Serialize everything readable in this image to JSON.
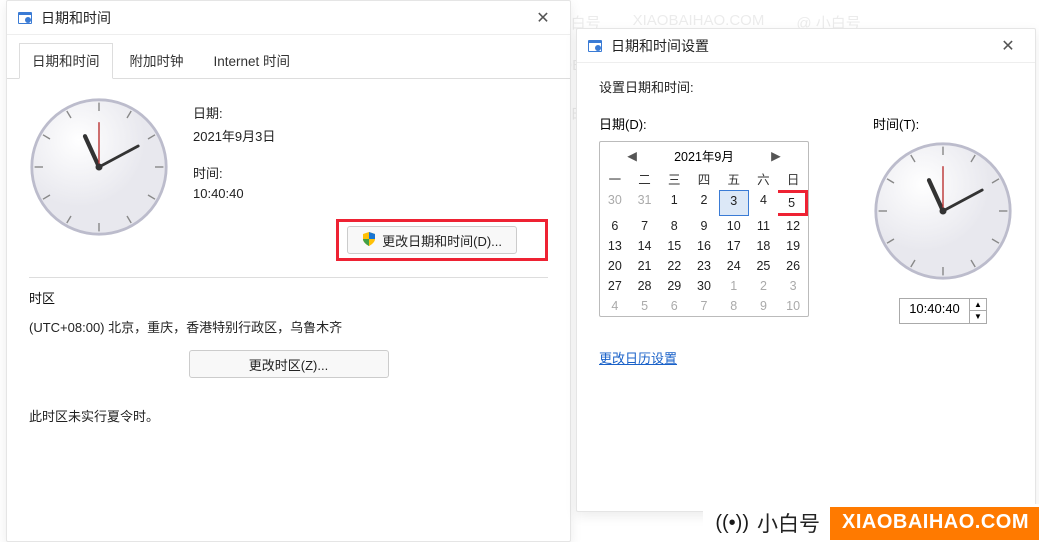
{
  "watermark": {
    "text1": "@ 小白号",
    "text2": "XIAOBAIHAO.COM"
  },
  "dialog1": {
    "title": "日期和时间",
    "tabs": [
      "日期和时间",
      "附加时钟",
      "Internet 时间"
    ],
    "date_label": "日期:",
    "date_value": "2021年9月3日",
    "time_label": "时间:",
    "time_value": "10:40:40",
    "change_datetime_btn": "更改日期和时间(D)...",
    "timezone_label": "时区",
    "timezone_value": "(UTC+08:00) 北京，重庆，香港特别行政区，乌鲁木齐",
    "change_timezone_btn": "更改时区(Z)...",
    "dst_note": "此时区未实行夏令时。"
  },
  "dialog2": {
    "title": "日期和时间设置",
    "set_label": "设置日期和时间:",
    "date_label": "日期(D):",
    "time_label": "时间(T):",
    "calendar": {
      "title": "2021年9月",
      "dow": [
        "一",
        "二",
        "三",
        "四",
        "五",
        "六",
        "日"
      ],
      "week1": [
        "30",
        "31",
        "1",
        "2",
        "3",
        "4",
        "5"
      ],
      "week2": [
        "6",
        "7",
        "8",
        "9",
        "10",
        "11",
        "12"
      ],
      "week3": [
        "13",
        "14",
        "15",
        "16",
        "17",
        "18",
        "19"
      ],
      "week4": [
        "20",
        "21",
        "22",
        "23",
        "24",
        "25",
        "26"
      ],
      "week5": [
        "27",
        "28",
        "29",
        "30",
        "1",
        "2",
        "3"
      ],
      "week6": [
        "4",
        "5",
        "6",
        "7",
        "8",
        "9",
        "10"
      ],
      "selected_day": "3",
      "highlighted_day": "5"
    },
    "time_value": "10:40:40",
    "change_calendar_link": "更改日历设置"
  },
  "brand": {
    "name": "小白号",
    "url": "XIAOBAIHAO.COM"
  }
}
